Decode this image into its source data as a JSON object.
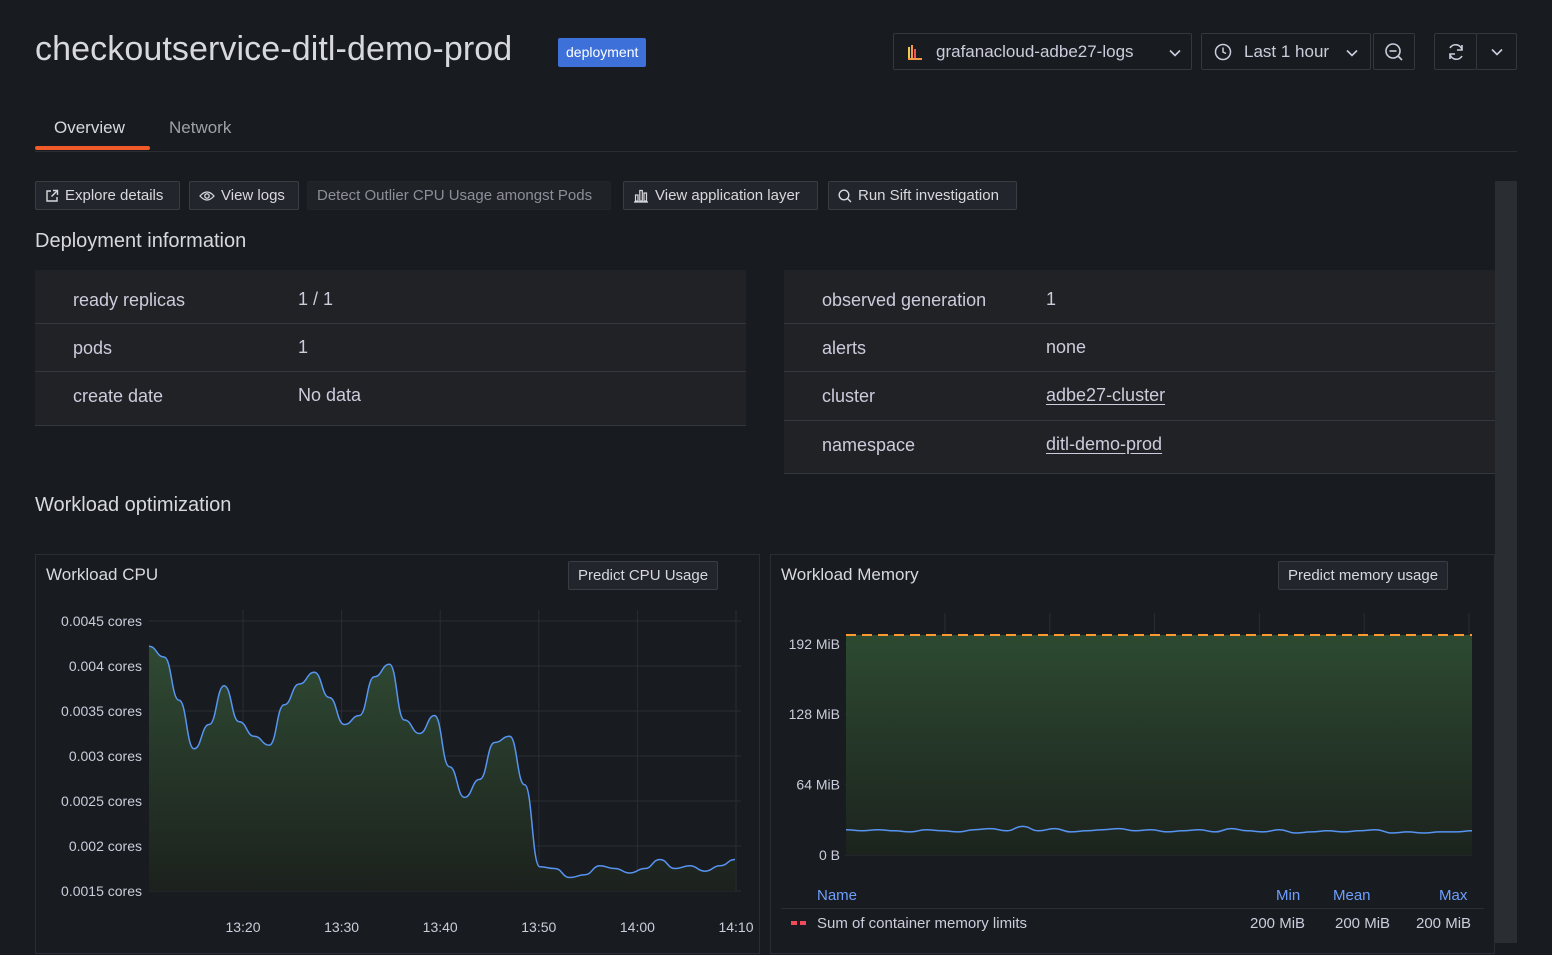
{
  "header": {
    "title": "checkoutservice-ditl-demo-prod",
    "badge": "deployment",
    "datasource": "grafanacloud-adbe27-logs",
    "time_range": "Last 1 hour"
  },
  "tabs": [
    {
      "label": "Overview",
      "active": true
    },
    {
      "label": "Network",
      "active": false
    }
  ],
  "actions": {
    "explore": "Explore details",
    "view_logs": "View logs",
    "detect_outlier": "Detect Outlier CPU Usage amongst Pods",
    "view_app_layer": "View application layer",
    "run_sift": "Run Sift investigation"
  },
  "deployment_info": {
    "title": "Deployment information",
    "left": [
      {
        "key": "ready replicas",
        "value": "1 / 1"
      },
      {
        "key": "pods",
        "value": "1"
      },
      {
        "key": "create date",
        "value": "No data"
      }
    ],
    "right": [
      {
        "key": "observed generation",
        "value": "1"
      },
      {
        "key": "alerts",
        "value": "none"
      },
      {
        "key": "cluster",
        "value": "adbe27-cluster"
      },
      {
        "key": "namespace",
        "value": "ditl-demo-prod"
      }
    ]
  },
  "workload_optimization": {
    "title": "Workload optimization",
    "cpu_panel": {
      "title": "Workload CPU",
      "button": "Predict CPU Usage"
    },
    "memory_panel": {
      "title": "Workload Memory",
      "button": "Predict memory usage",
      "legend": {
        "headers": {
          "name": "Name",
          "min": "Min",
          "mean": "Mean",
          "max": "Max"
        },
        "rows": [
          {
            "name": "Sum of container memory limits",
            "min": "200 MiB",
            "mean": "200 MiB",
            "max": "200 MiB"
          }
        ]
      }
    }
  },
  "colors": {
    "accent_tab": "#f05a28",
    "badge": "#3d71d9",
    "series_line": "#5794f2",
    "area_fill": "#2d4a31",
    "limit_line": "#ff9830",
    "legend_header": "#6e9fff",
    "legend_limit_swatch": "#f2495c"
  },
  "chart_data": [
    {
      "type": "area",
      "title": "Workload CPU",
      "unit": "cores",
      "x_ticks": [
        "13:20",
        "13:30",
        "13:40",
        "13:50",
        "14:00",
        "14:10"
      ],
      "y_ticks": [
        "0.0015 cores",
        "0.002 cores",
        "0.0025 cores",
        "0.003 cores",
        "0.0035 cores",
        "0.004 cores",
        "0.0045 cores"
      ],
      "ylim": [
        0.0015,
        0.0045
      ],
      "x": [
        "13:11",
        "13:12",
        "13:13",
        "13:14",
        "13:15",
        "13:16",
        "13:17",
        "13:18",
        "13:19",
        "13:20",
        "13:21",
        "13:22",
        "13:23",
        "13:24",
        "13:25",
        "13:26",
        "13:27",
        "13:28",
        "13:29",
        "13:30",
        "13:31",
        "13:32",
        "13:33",
        "13:34",
        "13:35",
        "13:36",
        "13:37",
        "13:38",
        "13:39",
        "13:40",
        "13:41",
        "13:42",
        "13:43",
        "13:44",
        "13:45",
        "13:46",
        "13:47",
        "13:48",
        "13:49",
        "13:50",
        "13:51",
        "13:52",
        "13:53",
        "13:54",
        "13:55",
        "13:56",
        "13:57",
        "13:58",
        "13:59",
        "14:00",
        "14:01",
        "14:02",
        "14:03",
        "14:04",
        "14:05",
        "14:06",
        "14:07",
        "14:08",
        "14:09",
        "14:10"
      ],
      "series": [
        {
          "values": [
            0.00422,
            0.0041,
            0.00362,
            0.00308,
            0.00335,
            0.00378,
            0.00338,
            0.00322,
            0.00312,
            0.00357,
            0.0038,
            0.00393,
            0.00365,
            0.00335,
            0.00345,
            0.00388,
            0.00402,
            0.0034,
            0.00325,
            0.00345,
            0.00288,
            0.00254,
            0.00274,
            0.00315,
            0.00322,
            0.00268,
            0.00177,
            0.00175,
            0.00165,
            0.00168,
            0.00178,
            0.00175,
            0.0017,
            0.00175,
            0.00185,
            0.00175,
            0.00178,
            0.00172,
            0.00178,
            0.00185
          ]
        }
      ]
    },
    {
      "type": "area",
      "title": "Workload Memory",
      "unit": "MiB",
      "x_ticks": [
        "13:20",
        "13:30",
        "13:40",
        "13:50",
        "14:00",
        "14:10"
      ],
      "y_ticks": [
        "0 B",
        "64 MiB",
        "128 MiB",
        "192 MiB"
      ],
      "ylim": [
        0,
        200
      ],
      "series": [
        {
          "name": "Sum of container memory limits",
          "style": "dashed",
          "values": [
            200,
            200,
            200,
            200,
            200,
            200,
            200,
            200,
            200,
            200,
            200,
            200,
            200,
            200,
            200,
            200,
            200,
            200,
            200,
            200,
            200,
            200,
            200,
            200,
            200,
            200,
            200,
            200,
            200,
            200,
            200,
            200,
            200,
            200,
            200,
            200,
            200,
            200,
            200,
            200
          ]
        },
        {
          "style": "area",
          "values": [
            23,
            22,
            23,
            22,
            21,
            23,
            22,
            21,
            23,
            24,
            22,
            26,
            22,
            24,
            21,
            22,
            23,
            24,
            22,
            23,
            21,
            22,
            23,
            21,
            24,
            22,
            21,
            23,
            20,
            21,
            22,
            21,
            22,
            23,
            20,
            21,
            20,
            21,
            21,
            22
          ]
        }
      ]
    }
  ]
}
